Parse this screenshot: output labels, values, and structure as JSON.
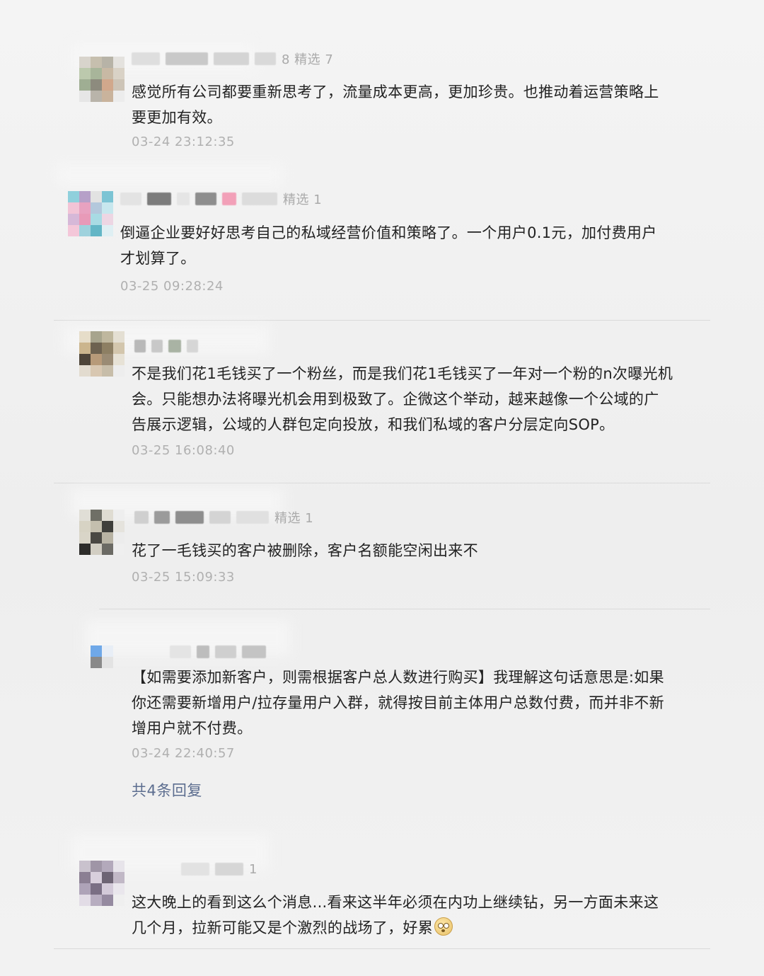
{
  "comments": [
    {
      "meta": "8 精选 7",
      "text": "感觉所有公司都要重新思考了，流量成本更高，更加珍贵。也推动着运营策略上\n要更加有效。",
      "time": "03-24 23:12:35"
    },
    {
      "meta": "精选 1",
      "text": "倒逼企业要好好思考自己的私域经营价值和策略了。一个用户0.1元，加付费用户\n才划算了。",
      "time": "03-25 09:28:24"
    },
    {
      "meta": "",
      "text": "不是我们花1毛钱买了一个粉丝，而是我们花1毛钱买了一年对一个粉的n次曝光机\n会。只能想办法将曝光机会用到极致了。企微这个举动，越来越像一个公域的广\n告展示逻辑，公域的人群包定向投放，和我们私域的客户分层定向SOP。",
      "time": "03-25 16:08:40"
    },
    {
      "meta": "精选 1",
      "text": "花了一毛钱买的客户被删除，客户名额能空闲出来不",
      "time": "03-25 15:09:33"
    },
    {
      "meta": "",
      "text": "【如需要添加新客户，则需根据客户总人数进行购买】我理解这句话意思是:如果\n你还需要新增用户/拉存量用户入群，就得按目前主体用户总数付费，而并非不新\n增用户就不付费。",
      "time": "03-24 22:40:57",
      "replies": "共4条回复"
    },
    {
      "meta": "1",
      "text": "这大晚上的看到这么个消息...看来这半年必须在内功上继续钻，另一方面未来这\n几个月，拉新可能又是个激烈的战场了，好累",
      "time": ""
    }
  ],
  "icons": {
    "emoji": "flushed-face-emoji"
  },
  "colors": {
    "background": "#f1f1f1",
    "text": "#222222",
    "meta": "#aaaaaa",
    "link": "#5c6d8f"
  }
}
